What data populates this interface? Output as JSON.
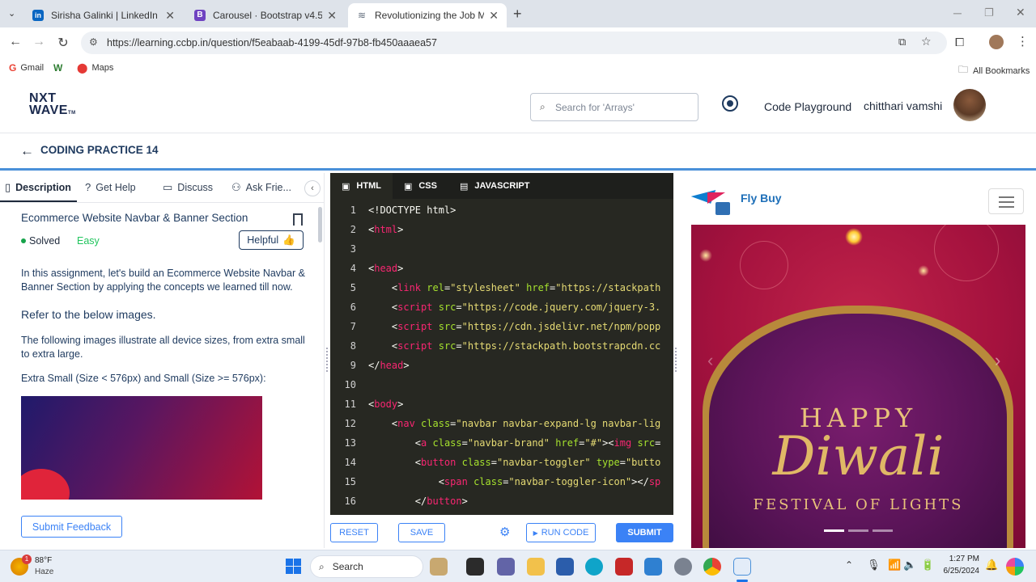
{
  "browser": {
    "tabs": [
      {
        "title": "Sirisha Galinki | LinkedIn",
        "fav_color": "#0a66c2",
        "fav_glyph": "in"
      },
      {
        "title": "Carousel · Bootstrap v4.5",
        "fav_color": "#6f42c1",
        "fav_glyph": "B"
      },
      {
        "title": "Revolutionizing the Job Market",
        "fav_color": "#5f6b7a",
        "fav_glyph": "≋"
      }
    ],
    "url": "https://learning.ccbp.in/question/f5eabaab-4199-45df-97b8-fb450aaaea57",
    "bookmarks": [
      {
        "label": "Gmail",
        "icon": "gmail-icon"
      },
      {
        "label": "",
        "icon": "w-icon"
      },
      {
        "label": "Maps",
        "icon": "maps-icon"
      }
    ],
    "all_bookmarks": "All Bookmarks"
  },
  "app": {
    "logo_line1": "NXT",
    "logo_line2": "WAVE",
    "logo_tm": "TM",
    "search_placeholder": "Search for 'Arrays'",
    "playground": "Code Playground",
    "user_name": "chitthari vamshi",
    "course_title": "CODING PRACTICE 14"
  },
  "left": {
    "tabs": [
      "Description",
      "Get Help",
      "Discuss",
      "Ask Frie..."
    ],
    "question_title": "Ecommerce Website Navbar & Banner Section",
    "status": "Solved",
    "difficulty": "Easy",
    "helpful": "Helpful",
    "para1": "In this assignment, let's build an Ecommerce Website Navbar & Banner Section by applying the concepts we learned till now.",
    "heading": "Refer to the below images.",
    "para2": "The following images illustrate all device sizes, from extra small to extra large.",
    "para3": "Extra Small (Size < 576px) and Small (Size >= 576px):",
    "feedback": "Submit Feedback"
  },
  "editor": {
    "tabs": [
      "HTML",
      "CSS",
      "JAVASCRIPT"
    ],
    "lines": [
      {
        "n": "1",
        "parts": [
          [
            "pl",
            "<!DOCTYPE html>"
          ]
        ]
      },
      {
        "n": "2",
        "parts": [
          [
            "pl",
            "<"
          ],
          [
            "tg",
            "html"
          ],
          [
            "pl",
            ">"
          ]
        ]
      },
      {
        "n": "3",
        "parts": []
      },
      {
        "n": "4",
        "parts": [
          [
            "pl",
            "<"
          ],
          [
            "tg",
            "head"
          ],
          [
            "pl",
            ">"
          ]
        ]
      },
      {
        "n": "5",
        "parts": [
          [
            "pl",
            "    <"
          ],
          [
            "tg",
            "link"
          ],
          [
            "pl",
            " "
          ],
          [
            "at",
            "rel"
          ],
          [
            "pl",
            "="
          ],
          [
            "st",
            "\"stylesheet\""
          ],
          [
            "pl",
            " "
          ],
          [
            "at",
            "href"
          ],
          [
            "pl",
            "="
          ],
          [
            "st",
            "\"https://stackpath"
          ]
        ]
      },
      {
        "n": "6",
        "parts": [
          [
            "pl",
            "    <"
          ],
          [
            "tg",
            "script"
          ],
          [
            "pl",
            " "
          ],
          [
            "at",
            "src"
          ],
          [
            "pl",
            "="
          ],
          [
            "st",
            "\"https://code.jquery.com/jquery-3."
          ]
        ]
      },
      {
        "n": "7",
        "parts": [
          [
            "pl",
            "    <"
          ],
          [
            "tg",
            "script"
          ],
          [
            "pl",
            " "
          ],
          [
            "at",
            "src"
          ],
          [
            "pl",
            "="
          ],
          [
            "st",
            "\"https://cdn.jsdelivr.net/npm/popp"
          ]
        ]
      },
      {
        "n": "8",
        "parts": [
          [
            "pl",
            "    <"
          ],
          [
            "tg",
            "script"
          ],
          [
            "pl",
            " "
          ],
          [
            "at",
            "src"
          ],
          [
            "pl",
            "="
          ],
          [
            "st",
            "\"https://stackpath.bootstrapcdn.cc"
          ]
        ]
      },
      {
        "n": "9",
        "parts": [
          [
            "pl",
            "</"
          ],
          [
            "tg",
            "head"
          ],
          [
            "pl",
            ">"
          ]
        ]
      },
      {
        "n": "10",
        "parts": []
      },
      {
        "n": "11",
        "parts": [
          [
            "pl",
            "<"
          ],
          [
            "tg",
            "body"
          ],
          [
            "pl",
            ">"
          ]
        ]
      },
      {
        "n": "12",
        "parts": [
          [
            "pl",
            "    <"
          ],
          [
            "tg",
            "nav"
          ],
          [
            "pl",
            " "
          ],
          [
            "at",
            "class"
          ],
          [
            "pl",
            "="
          ],
          [
            "st",
            "\"navbar navbar-expand-lg navbar-lig"
          ]
        ]
      },
      {
        "n": "13",
        "parts": [
          [
            "pl",
            "        <"
          ],
          [
            "tg",
            "a"
          ],
          [
            "pl",
            " "
          ],
          [
            "at",
            "class"
          ],
          [
            "pl",
            "="
          ],
          [
            "st",
            "\"navbar-brand\""
          ],
          [
            "pl",
            " "
          ],
          [
            "at",
            "href"
          ],
          [
            "pl",
            "="
          ],
          [
            "st",
            "\"#\""
          ],
          [
            "pl",
            "><"
          ],
          [
            "tg",
            "img"
          ],
          [
            "pl",
            " "
          ],
          [
            "at",
            "src"
          ],
          [
            "pl",
            "="
          ]
        ]
      },
      {
        "n": "14",
        "parts": [
          [
            "pl",
            "        <"
          ],
          [
            "tg",
            "button"
          ],
          [
            "pl",
            " "
          ],
          [
            "at",
            "class"
          ],
          [
            "pl",
            "="
          ],
          [
            "st",
            "\"navbar-toggler\""
          ],
          [
            "pl",
            " "
          ],
          [
            "at",
            "type"
          ],
          [
            "pl",
            "="
          ],
          [
            "st",
            "\"butto"
          ]
        ]
      },
      {
        "n": "15",
        "parts": [
          [
            "pl",
            "            <"
          ],
          [
            "tg",
            "span"
          ],
          [
            "pl",
            " "
          ],
          [
            "at",
            "class"
          ],
          [
            "pl",
            "="
          ],
          [
            "st",
            "\"navbar-toggler-icon\""
          ],
          [
            "pl",
            "></"
          ],
          [
            "tg",
            "sp"
          ]
        ]
      },
      {
        "n": "16",
        "parts": [
          [
            "pl",
            "        </"
          ],
          [
            "tg",
            "button"
          ],
          [
            "pl",
            ">"
          ]
        ]
      }
    ],
    "reset": "RESET",
    "save": "SAVE",
    "run": "RUN CODE",
    "submit": "SUBMIT"
  },
  "preview": {
    "brand": "Fly Buy",
    "banner_line1": "HAPPY",
    "banner_line2": "Diwali",
    "banner_line3": "FESTIVAL OF LIGHTS"
  },
  "taskbar": {
    "weather_temp": "88°F",
    "weather_desc": "Haze",
    "weather_badge": "1",
    "search": "Search",
    "time": "1:27 PM",
    "date": "6/25/2024"
  },
  "colors": {
    "accent": "#3b82f6",
    "solved": "#16a34a",
    "easy": "#22c55e",
    "editor_bg": "#272822"
  }
}
